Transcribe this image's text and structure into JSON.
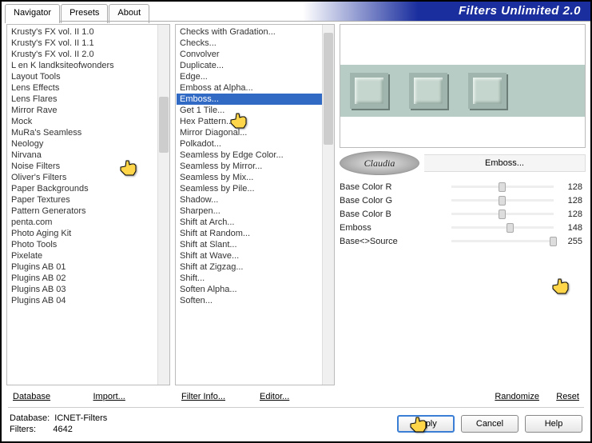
{
  "title": "Filters Unlimited 2.0",
  "tabs": [
    "Navigator",
    "Presets",
    "About"
  ],
  "active_tab": 0,
  "categories": [
    "Krusty's FX vol. II 1.0",
    "Krusty's FX vol. II 1.1",
    "Krusty's FX vol. II 2.0",
    "L en K landksiteofwonders",
    "Layout Tools",
    "Lens Effects",
    "Lens Flares",
    "Mirror Rave",
    "Mock",
    "MuRa's Seamless",
    "Neology",
    "Nirvana",
    "Noise Filters",
    "Oliver's Filters",
    "Paper Backgrounds",
    "Paper Textures",
    "Pattern Generators",
    "penta.com",
    "Photo Aging Kit",
    "Photo Tools",
    "Pixelate",
    "Plugins AB 01",
    "Plugins AB 02",
    "Plugins AB 03",
    "Plugins AB 04"
  ],
  "category_selected": 9,
  "filters": [
    "Checks with Gradation...",
    "Checks...",
    "Convolver",
    "Duplicate...",
    "Edge...",
    "Emboss at Alpha...",
    "Emboss...",
    "Get 1 Tile...",
    "Hex Pattern...",
    "Mirror Diagonal...",
    "Polkadot...",
    "Seamless by Edge Color...",
    "Seamless by Mirror...",
    "Seamless by Mix...",
    "Seamless by Pile...",
    "Shadow...",
    "Sharpen...",
    "Shift at Arch...",
    "Shift at Random...",
    "Shift at Slant...",
    "Shift at Wave...",
    "Shift at Zigzag...",
    "Shift...",
    "Soften Alpha...",
    "Soften..."
  ],
  "filter_selected": 6,
  "col1_buttons": {
    "database": "Database",
    "import": "Import..."
  },
  "col2_buttons": {
    "filterinfo": "Filter Info...",
    "editor": "Editor..."
  },
  "right_buttons": {
    "randomize": "Randomize",
    "reset": "Reset"
  },
  "current_filter": "Emboss...",
  "badge_text": "Claudia",
  "params": [
    {
      "label": "Base Color R",
      "value": 128,
      "pos": 50
    },
    {
      "label": "Base Color G",
      "value": 128,
      "pos": 50
    },
    {
      "label": "Base Color B",
      "value": 128,
      "pos": 50
    },
    {
      "label": "Emboss",
      "value": 148,
      "pos": 58
    },
    {
      "label": "Base<>Source",
      "value": 255,
      "pos": 100
    }
  ],
  "footer": {
    "db_label": "Database:",
    "db_value": "ICNET-Filters",
    "filters_label": "Filters:",
    "filters_value": "4642"
  },
  "buttons": {
    "apply": "Apply",
    "cancel": "Cancel",
    "help": "Help"
  }
}
